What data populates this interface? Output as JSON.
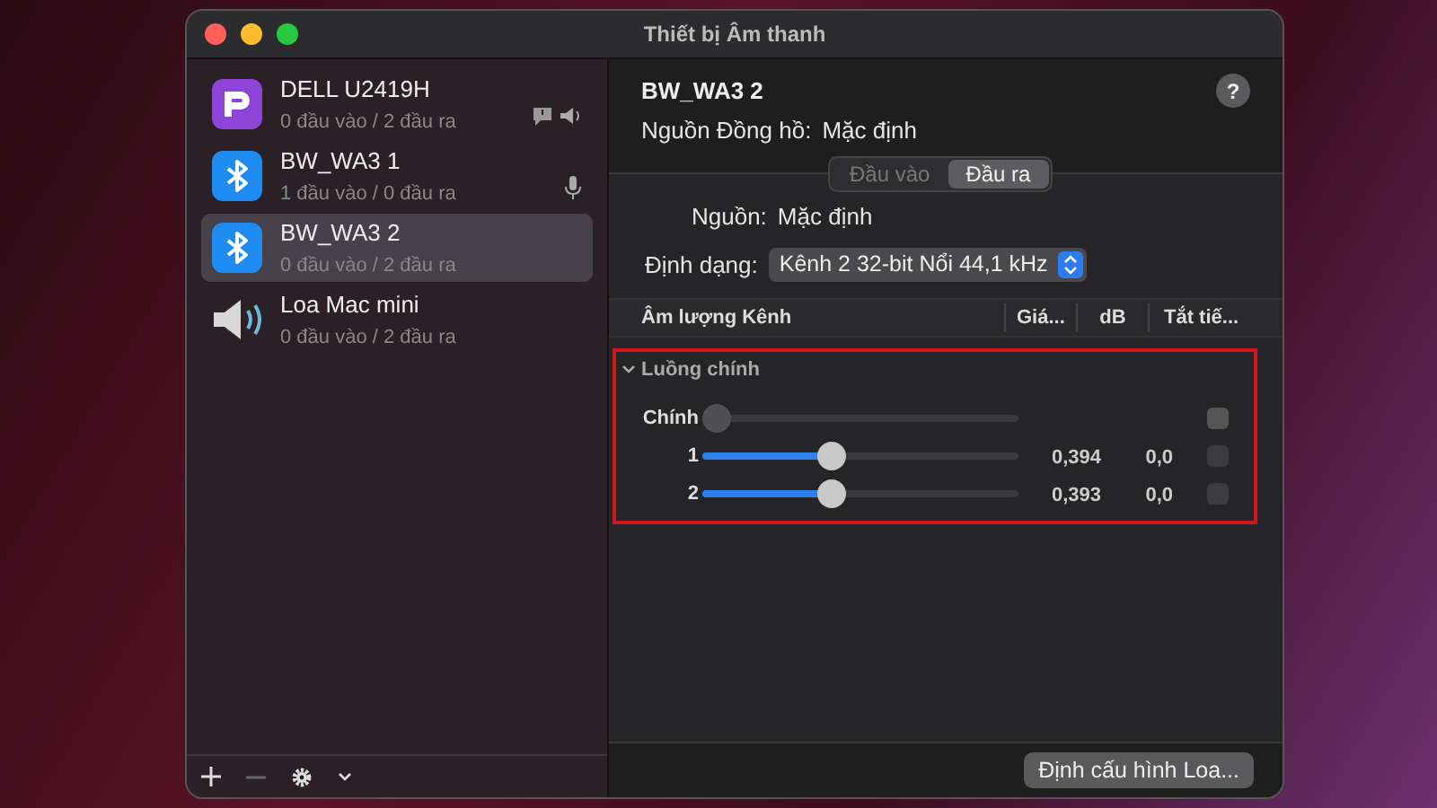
{
  "window": {
    "title": "Thiết bị Âm thanh"
  },
  "devices": [
    {
      "name": "DELL U2419H",
      "io": "0 đầu vào / 2 đầu ra",
      "kind": "display",
      "selected": false,
      "system_output": true,
      "default_output": true,
      "default_input": false
    },
    {
      "name": "BW_WA3 1",
      "io": "1 đầu vào / 0 đầu ra",
      "kind": "bluetooth",
      "selected": false,
      "system_output": false,
      "default_output": false,
      "default_input": true
    },
    {
      "name": "BW_WA3 2",
      "io": "0 đầu vào / 2 đầu ra",
      "kind": "bluetooth",
      "selected": true,
      "system_output": false,
      "default_output": false,
      "default_input": false
    },
    {
      "name": "Loa Mac mini",
      "io": "0 đầu vào / 2 đầu ra",
      "kind": "speaker",
      "selected": false,
      "system_output": false,
      "default_output": false,
      "default_input": false
    }
  ],
  "detail": {
    "title": "BW_WA3 2",
    "help": "?",
    "clock_label": "Nguồn Đồng hồ:",
    "clock_value": "Mặc định",
    "tabs": [
      {
        "label": "Đầu vào",
        "selected": false
      },
      {
        "label": "Đầu ra",
        "selected": true
      }
    ],
    "source_label": "Nguồn:",
    "source_value": "Mặc định",
    "format_label": "Định dạng:",
    "format_value": "Kênh 2 32-bit Nổi 44,1 kHz",
    "columns": [
      "Âm lượng Kênh",
      "Giá...",
      "dB",
      "Tắt tiế..."
    ],
    "stream": {
      "title": "Luồng chính",
      "expanded": true,
      "channels": [
        {
          "name": "Chính",
          "level": 0,
          "muted": false,
          "disabled": true
        },
        {
          "name": "1",
          "level": 0.4,
          "value": "0,394",
          "db": "0,0",
          "muted": false,
          "disabled": false
        },
        {
          "name": "2",
          "level": 0.4,
          "value": "0,393",
          "db": "0,0",
          "muted": false,
          "disabled": false
        }
      ]
    },
    "configure_button": "Định cấu hình Loa..."
  }
}
